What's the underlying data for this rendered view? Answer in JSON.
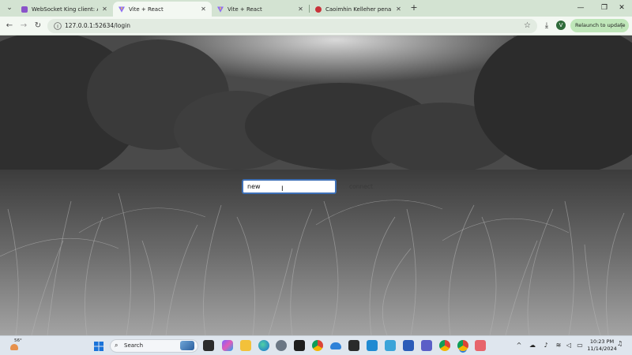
{
  "browser": {
    "tabs": [
      {
        "title": "WebSocket King client: A testin",
        "icon": "websocketking-favicon",
        "active": false
      },
      {
        "title": "Vite + React",
        "icon": "vite-favicon",
        "active": true
      },
      {
        "title": "Vite + React",
        "icon": "vite-favicon",
        "active": false
      },
      {
        "title": "Caoimhin Kelleher penalty save",
        "icon": "news-favicon",
        "active": false
      }
    ],
    "url": "127.0.0.1:52634/login",
    "relaunch_label": "Relaunch to update",
    "profile_initial": "V"
  },
  "login": {
    "input_value": "new",
    "connect_label": "connect"
  },
  "taskbar": {
    "temperature": "56°",
    "search_label": "Search",
    "time": "10:23 PM",
    "date": "11/14/2024"
  },
  "colors": {
    "tab_strip": "#d3e3d2",
    "toolbar": "#f3f8f2",
    "relaunch_bg": "#bfe6b9",
    "input_border": "#3d6fb6",
    "taskbar": "#dfe6ee"
  }
}
